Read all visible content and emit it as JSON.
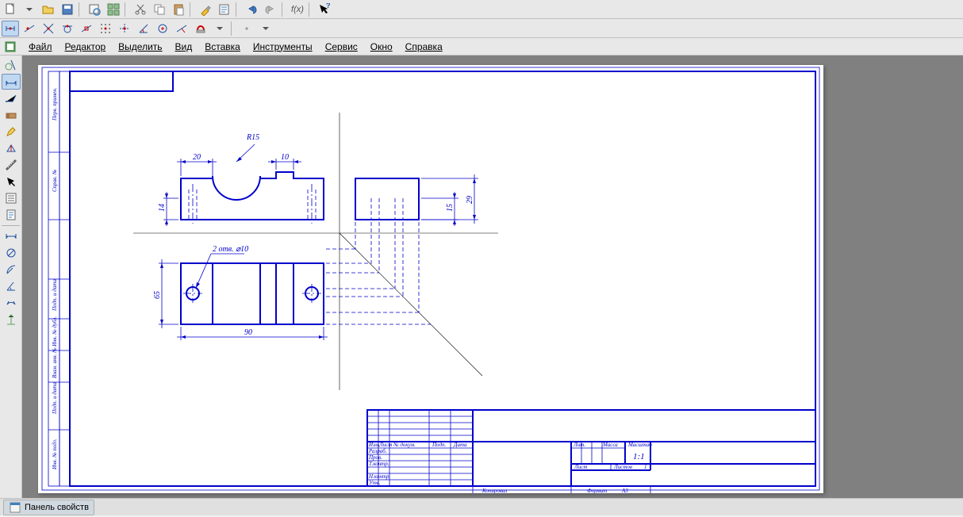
{
  "menu": {
    "file": "Файл",
    "editor": "Редактор",
    "select": "Выделить",
    "view": "Вид",
    "insert": "Вставка",
    "tools": "Инструменты",
    "service": "Сервис",
    "window": "Окно",
    "help": "Справка"
  },
  "status": {
    "properties_panel": "Панель свойств"
  },
  "drawing": {
    "dimensions": {
      "d20": "20",
      "d10": "10",
      "d14": "14",
      "d15": "15",
      "d29": "29",
      "d90": "90",
      "d65": "65",
      "r15": "R15",
      "holes": "2 отв. ⌀10"
    },
    "title_block": {
      "izm": "Изм.",
      "list": "Лист",
      "num_doc": "№ докум.",
      "podp": "Подп.",
      "data": "Дата",
      "razrab": "Разраб.",
      "prov": "Пров.",
      "tkontr": "Т.контр.",
      "nkontr": "Н.контр.",
      "utv": "Утв.",
      "lit": "Лит.",
      "massa": "Масса",
      "mashtab": "Масштаб",
      "scale": "1:1",
      "list2": "Лист",
      "listov": "Листов",
      "listov_val": "1",
      "kopiroval": "Копировал",
      "format": "Формат",
      "format_val": "А3"
    },
    "side_labels": {
      "l1": "Перв. примен.",
      "l2": "Справ. №",
      "l3": "Подп. и дата",
      "l4": "Инв. № дубл.",
      "l5": "Взам. инв. №",
      "l6": "Подп. и дата",
      "l7": "Инв. № подл."
    }
  },
  "fx_label": "f(x)"
}
